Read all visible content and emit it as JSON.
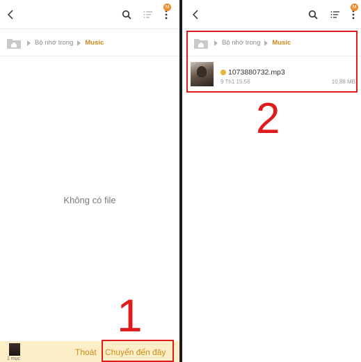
{
  "left_panel": {
    "breadcrumb": {
      "root": "Bộ nhớ trong",
      "current": "Music"
    },
    "empty_message": "Không có file",
    "bottom_bar": {
      "selection_label": "1 mục",
      "exit_label": "Thoát",
      "move_here_label": "Chuyển đến đây"
    },
    "step_number": "1"
  },
  "right_panel": {
    "breadcrumb": {
      "root": "Bộ nhớ trong",
      "current": "Music"
    },
    "files": [
      {
        "name": "1073880732.mp3",
        "date": "9 Th1 15:56",
        "size": "10,88 MB"
      }
    ],
    "step_number": "2"
  },
  "header": {
    "badge": "M"
  },
  "icons": [
    "back-arrow-icon",
    "search-icon",
    "sort-icon",
    "more-vertical-icon",
    "folder-home-icon"
  ],
  "colors": {
    "accent": "#c88a1b",
    "highlight": "#e01b1b",
    "bottom_bar_bg": "#fcefc8",
    "badge": "#f08a2a"
  }
}
